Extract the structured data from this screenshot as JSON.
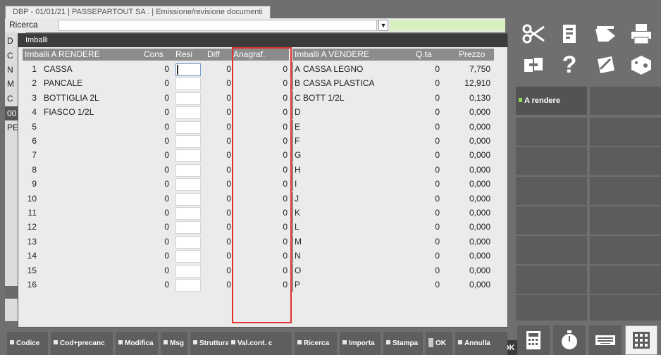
{
  "window": {
    "title": "DBP - 01/01/21 | PASSEPARTOUT SA . | Emissione/revisione documenti"
  },
  "search": {
    "label": "Ricerca",
    "value": "",
    "dropdown_icon": "dropdown-arrow-icon"
  },
  "background_rows": {
    "labels": [
      "D",
      "C",
      "N",
      "M",
      "C",
      "00",
      "PE"
    ]
  },
  "dialog": {
    "title": "Imballi",
    "headers": {
      "render": "Imballi A RENDERE",
      "cons": "Cons",
      "resi": "Resi",
      "diff": "Diff",
      "anagraf": "Anagraf.",
      "vendere": "Imballi A VENDERE",
      "qta": "Q.ta",
      "prezzo": "Prezzo"
    },
    "rows": [
      {
        "num": "1",
        "name": "CASSA",
        "cons": "0",
        "resi": "",
        "diff": "0",
        "anagraf": "0",
        "letter": "A",
        "vendere": "CASSA LEGNO",
        "qta": "0",
        "prezzo": "7,750"
      },
      {
        "num": "2",
        "name": "PANCALE",
        "cons": "0",
        "resi": "",
        "diff": "0",
        "anagraf": "0",
        "letter": "B",
        "vendere": "CASSA PLASTICA",
        "qta": "0",
        "prezzo": "12,910"
      },
      {
        "num": "3",
        "name": "BOTTIGLIA 2L",
        "cons": "0",
        "resi": "",
        "diff": "0",
        "anagraf": "0",
        "letter": "C",
        "vendere": "BOTT 1/2L",
        "qta": "0",
        "prezzo": "0,130"
      },
      {
        "num": "4",
        "name": "FIASCO 1/2L",
        "cons": "0",
        "resi": "",
        "diff": "0",
        "anagraf": "0",
        "letter": "D",
        "vendere": "",
        "qta": "0",
        "prezzo": "0,000"
      },
      {
        "num": "5",
        "name": "",
        "cons": "0",
        "resi": "",
        "diff": "0",
        "anagraf": "0",
        "letter": "E",
        "vendere": "",
        "qta": "0",
        "prezzo": "0,000"
      },
      {
        "num": "6",
        "name": "",
        "cons": "0",
        "resi": "",
        "diff": "0",
        "anagraf": "0",
        "letter": "F",
        "vendere": "",
        "qta": "0",
        "prezzo": "0,000"
      },
      {
        "num": "7",
        "name": "",
        "cons": "0",
        "resi": "",
        "diff": "0",
        "anagraf": "0",
        "letter": "G",
        "vendere": "",
        "qta": "0",
        "prezzo": "0,000"
      },
      {
        "num": "8",
        "name": "",
        "cons": "0",
        "resi": "",
        "diff": "0",
        "anagraf": "0",
        "letter": "H",
        "vendere": "",
        "qta": "0",
        "prezzo": "0,000"
      },
      {
        "num": "9",
        "name": "",
        "cons": "0",
        "resi": "",
        "diff": "0",
        "anagraf": "0",
        "letter": "I",
        "vendere": "",
        "qta": "0",
        "prezzo": "0,000"
      },
      {
        "num": "10",
        "name": "",
        "cons": "0",
        "resi": "",
        "diff": "0",
        "anagraf": "0",
        "letter": "J",
        "vendere": "",
        "qta": "0",
        "prezzo": "0,000"
      },
      {
        "num": "11",
        "name": "",
        "cons": "0",
        "resi": "",
        "diff": "0",
        "anagraf": "0",
        "letter": "K",
        "vendere": "",
        "qta": "0",
        "prezzo": "0,000"
      },
      {
        "num": "12",
        "name": "",
        "cons": "0",
        "resi": "",
        "diff": "0",
        "anagraf": "0",
        "letter": "L",
        "vendere": "",
        "qta": "0",
        "prezzo": "0,000"
      },
      {
        "num": "13",
        "name": "",
        "cons": "0",
        "resi": "",
        "diff": "0",
        "anagraf": "0",
        "letter": "M",
        "vendere": "",
        "qta": "0",
        "prezzo": "0,000"
      },
      {
        "num": "14",
        "name": "",
        "cons": "0",
        "resi": "",
        "diff": "0",
        "anagraf": "0",
        "letter": "N",
        "vendere": "",
        "qta": "0",
        "prezzo": "0,000"
      },
      {
        "num": "15",
        "name": "",
        "cons": "0",
        "resi": "",
        "diff": "0",
        "anagraf": "0",
        "letter": "O",
        "vendere": "",
        "qta": "0",
        "prezzo": "0,000"
      },
      {
        "num": "16",
        "name": "",
        "cons": "0",
        "resi": "",
        "diff": "0",
        "anagraf": "0",
        "letter": "P",
        "vendere": "",
        "qta": "0",
        "prezzo": "0,000"
      }
    ],
    "ok_label": "OK"
  },
  "right_toolbar": {
    "icons": [
      "scissors-icon",
      "paste-icon",
      "eraser-icon",
      "printer-icon",
      "window-switch-icon",
      "help-icon",
      "edit-note-icon",
      "dice-icon"
    ],
    "help_glyph": "?"
  },
  "right_panel": {
    "a_rendere": "A rendere"
  },
  "function_bar": [
    "Codice",
    "Cod+precanc",
    "Modifica",
    "Msg",
    "Struttura",
    "Val.cont. c",
    "Ricerca",
    "Importa",
    "Stampa",
    "OK",
    "Annulla"
  ],
  "bottom_icons": [
    "calculator-icon",
    "stopwatch-icon",
    "keyboard-icon",
    "grid-menu-icon"
  ],
  "colors": {
    "highlight_box": "#e0312f",
    "ok_green": "#7fdd4e",
    "header_bg": "#8c8c8c"
  }
}
